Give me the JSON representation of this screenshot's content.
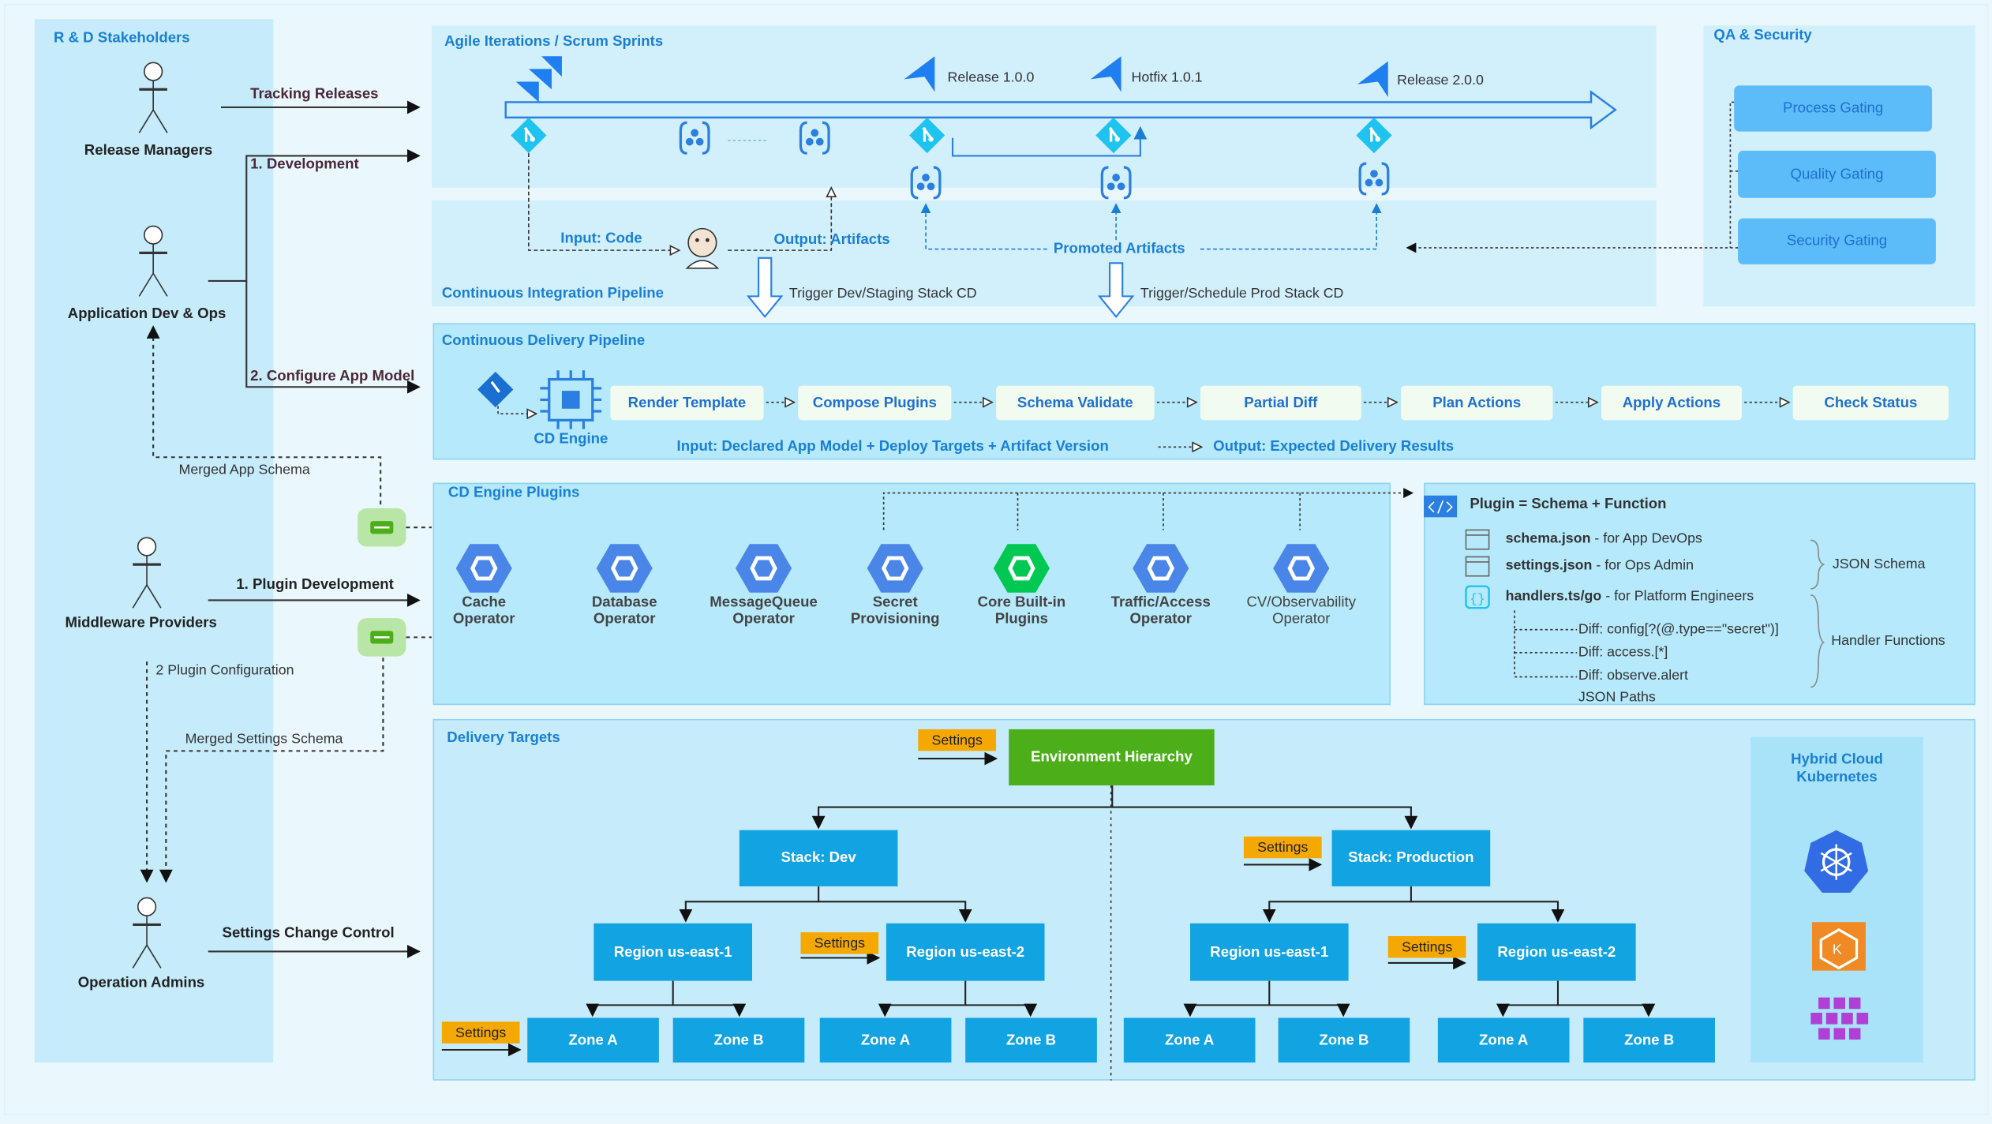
{
  "colors": {
    "panel": "#c6ecfb",
    "accent": "#1a7fd4",
    "box": "#12a3e3",
    "settings": "#f5a800",
    "env": "#4caf1a",
    "gate": "#5bbcf9",
    "step": "#f1fbef"
  },
  "stakeholders": {
    "title": "R & D Stakeholders",
    "actors": [
      "Release Managers",
      "Application Dev & Ops",
      "Middleware Providers",
      "Operation Admins"
    ]
  },
  "flows": {
    "tracking": "Tracking Releases",
    "development": "1. Development",
    "configure": "2. Configure App Model",
    "merged_app_schema": "Merged App Schema",
    "plugin_dev": "1. Plugin Development",
    "plugin_config": "2 Plugin Configuration",
    "merged_settings_schema": "Merged Settings Schema",
    "settings_change": "Settings Change Control"
  },
  "agile": {
    "title": "Agile Iterations / Scrum Sprints",
    "releases": [
      "Release 1.0.0",
      "Hotfix 1.0.1",
      "Release 2.0.0"
    ]
  },
  "ci": {
    "title": "Continuous Integration Pipeline",
    "input": "Input: Code",
    "output": "Output: Artifacts",
    "promoted": "Promoted Artifacts",
    "trigger_dev": "Trigger Dev/Staging Stack CD",
    "trigger_prod": "Trigger/Schedule Prod Stack CD"
  },
  "qa": {
    "title": "QA & Security",
    "gates": [
      "Process Gating",
      "Quality Gating",
      "Security Gating"
    ]
  },
  "cd": {
    "title": "Continuous Delivery Pipeline",
    "engine": "CD Engine",
    "steps": [
      "Render Template",
      "Compose Plugins",
      "Schema Validate",
      "Partial Diff",
      "Plan Actions",
      "Apply Actions",
      "Check Status"
    ],
    "input": "Input: Declared App Model + Deploy Targets + Artifact Version",
    "output": "Output: Expected Delivery Results"
  },
  "plugins": {
    "title": "CD Engine Plugins",
    "items": [
      [
        "Cache",
        "Operator"
      ],
      [
        "Database",
        "Operator"
      ],
      [
        "MessageQueue",
        "Operator"
      ],
      [
        "Secret",
        "Provisioning"
      ],
      [
        "Core Built-in",
        "Plugins"
      ],
      [
        "Traffic/Access",
        "Operator"
      ],
      [
        "CV/Observability",
        "Operator"
      ]
    ]
  },
  "plugin_def": {
    "title": "Plugin = Schema + Function",
    "files": [
      {
        "name": "schema.json",
        "desc": " - for App DevOps"
      },
      {
        "name": "settings.json",
        "desc": " - for Ops Admin"
      },
      {
        "name": "handlers.ts/go",
        "desc": " - for Platform Engineers"
      }
    ],
    "diffs": [
      "Diff: config[?(@.type==\"secret\")]",
      "Diff: access.[*]",
      "Diff: observe.alert"
    ],
    "json_paths": "JSON Paths",
    "json_schema": "JSON Schema",
    "handler_functions": "Handler Functions"
  },
  "targets": {
    "title": "Delivery Targets",
    "settings": "Settings",
    "env": "Environment Hierarchy",
    "stacks": [
      "Stack: Dev",
      "Stack: Production"
    ],
    "regions": [
      "Region us-east-1",
      "Region us-east-2",
      "Region us-east-1",
      "Region us-east-2"
    ],
    "zones": [
      "Zone A",
      "Zone B",
      "Zone A",
      "Zone B",
      "Zone A",
      "Zone B",
      "Zone A",
      "Zone B"
    ]
  },
  "cloud": {
    "title": "Hybrid Cloud Kubernetes",
    "icons": [
      "kubernetes-icon",
      "kubesphere-icon",
      "cluster-icon"
    ]
  }
}
